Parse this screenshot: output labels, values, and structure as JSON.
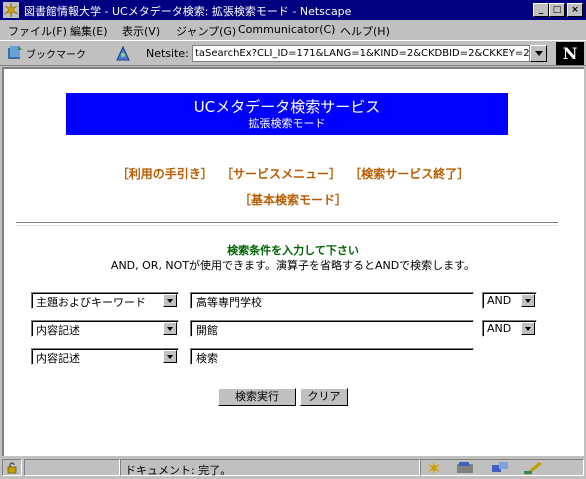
{
  "window": {
    "title": "図書館情報大学 - UCメタデータ検索: 拡張検索モード - Netscape",
    "min_icon": "minimize-icon",
    "max_icon": "maximize-icon",
    "close_icon": "close-icon"
  },
  "menu": {
    "file": "ファイル(F)",
    "edit": "編集(E)",
    "view": "表示(V)",
    "go": "ジャンプ(G)",
    "communicator": "Communicator(C)",
    "help": "ヘルプ(H)"
  },
  "toolbar": {
    "bookmarks": "ブックマーク",
    "netsite_label": "Netsite:",
    "url": "taSearchEx?CLI_ID=171&LANG=1&KIND=2&CKDBID=2&CKKEY=2"
  },
  "page": {
    "banner_title": "UCメタデータ検索サービス",
    "banner_subtitle": "拡張検索モード",
    "links_row1": [
      "［利用の手引き］",
      "［サービスメニュー］",
      "［検索サービス終了］"
    ],
    "links_row2": [
      "［基本検索モード］"
    ],
    "instruction_title": "検索条件を入力して下さい",
    "instruction_text": "AND, OR, NOTが使用できます。演算子を省略するとANDで検索します。",
    "rows": [
      {
        "field": "主題およびキーワード",
        "value": "高等専門学校",
        "op": "AND"
      },
      {
        "field": "内容記述",
        "value": "開館",
        "op": "AND"
      },
      {
        "field": "内容記述",
        "value": "検索"
      }
    ],
    "search_button": "検索実行",
    "clear_button": "クリア"
  },
  "status": {
    "text": "ドキュメント: 完了。"
  }
}
